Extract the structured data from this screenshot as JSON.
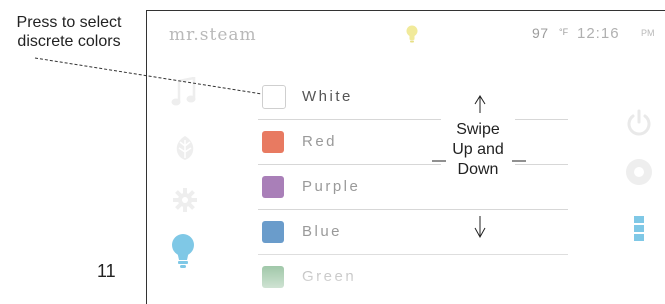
{
  "annotation": {
    "callout": "Press to select discrete colors",
    "swipe": [
      "Swipe",
      "Up and",
      "Down"
    ],
    "page_number": "11"
  },
  "header": {
    "brand": "mr.steam",
    "temperature": "97",
    "temperature_unit": "°F",
    "time": "12:16",
    "ampm": "PM"
  },
  "left_nav": [
    "music-icon",
    "aromatherapy-icon",
    "settings-gear-icon",
    "light-bulb-icon"
  ],
  "right_nav": [
    "power-icon",
    "record-icon",
    "level-indicator-icon"
  ],
  "colors": [
    {
      "label": "White",
      "swatch": "#ffffff",
      "selected": true
    },
    {
      "label": "Red",
      "swatch": "#e87a61"
    },
    {
      "label": "Purple",
      "swatch": "#a97fb8"
    },
    {
      "label": "Blue",
      "swatch": "#6a9ccb"
    },
    {
      "label": "Green",
      "swatch": "#6fab7c"
    }
  ],
  "accent": "#7fc8e6"
}
